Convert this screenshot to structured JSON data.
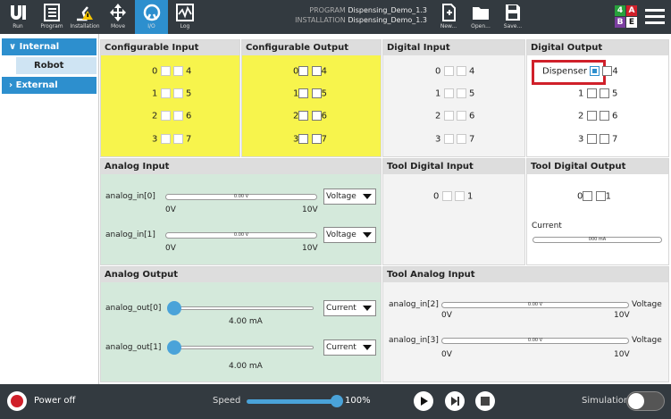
{
  "toolbar": {
    "run": "Run",
    "program": "Program",
    "installation": "Installation",
    "move": "Move",
    "io": "I/O",
    "log": "Log",
    "new": "New...",
    "open": "Open...",
    "save": "Save..."
  },
  "program_info": {
    "program_label": "PROGRAM",
    "program_value": "Dispensing_Demo_1.3",
    "installation_label": "INSTALLATION",
    "installation_value": "Dispensing_Demo_1.3"
  },
  "badges": [
    "4",
    "A",
    "B",
    "E"
  ],
  "nav": {
    "internal": "Internal",
    "robot": "Robot",
    "external": "External"
  },
  "panels": {
    "conf_in": "Configurable Input",
    "conf_out": "Configurable Output",
    "dig_in": "Digital Input",
    "dig_out": "Digital Output",
    "analog_in": "Analog Input",
    "tool_dig_in": "Tool Digital Input",
    "tool_dig_out": "Tool Digital Output",
    "analog_out": "Analog Output",
    "tool_analog_in": "Tool Analog Input"
  },
  "numbers": {
    "n0": "0",
    "n1": "1",
    "n2": "2",
    "n3": "3",
    "n4": "4",
    "n5": "5",
    "n6": "6",
    "n7": "7"
  },
  "dispenser": "Dispenser",
  "analog_in": {
    "a0": "analog_in[0]",
    "a1": "analog_in[1]",
    "bar": "0.00 V",
    "min": "0V",
    "max": "10V",
    "mode": "Voltage"
  },
  "tool_out": {
    "current": "Current",
    "value": "000 mA"
  },
  "analog_out": {
    "a0": "analog_out[0]",
    "a1": "analog_out[1]",
    "value": "4.00 mA",
    "mode": "Current"
  },
  "tool_analog": {
    "a2": "analog_in[2]",
    "a3": "analog_in[3]",
    "bar": "0.00 V",
    "min": "0V",
    "max": "10V",
    "mode": "Voltage"
  },
  "bottom": {
    "power": "Power off",
    "speed": "Speed",
    "speed_value": "100%",
    "simulation": "Simulation"
  }
}
